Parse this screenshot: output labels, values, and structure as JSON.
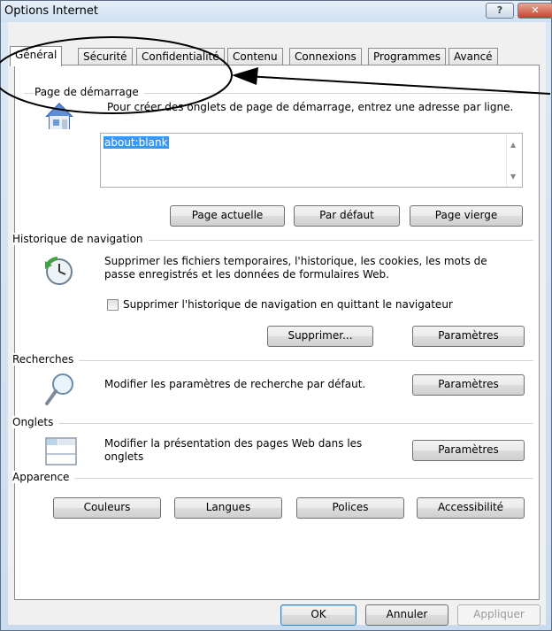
{
  "window": {
    "title": "Options Internet",
    "help_label": "?",
    "close_label": "✕"
  },
  "tabs": [
    {
      "label": "Général",
      "active": true
    },
    {
      "label": "Sécurité"
    },
    {
      "label": "Confidentialité"
    },
    {
      "label": "Contenu"
    },
    {
      "label": "Connexions"
    },
    {
      "label": "Programmes"
    },
    {
      "label": "Avancé"
    }
  ],
  "homepage": {
    "group_label": "Page de démarrage",
    "description": "Pour créer des onglets de page de démarrage, entrez une adresse par ligne.",
    "value": "about:blank",
    "icon": "house-icon",
    "buttons": {
      "current": "Page actuelle",
      "default": "Par défaut",
      "blank": "Page vierge"
    }
  },
  "history": {
    "group_label": "Historique de navigation",
    "description": "Supprimer les fichiers temporaires, l'historique, les cookies, les mots de passe enregistrés et les données de formulaires Web.",
    "checkbox_label": "Supprimer l'historique de navigation en quittant le navigateur",
    "checked": false,
    "icon": "history-clock-icon",
    "buttons": {
      "delete": "Supprimer...",
      "settings": "Paramètres"
    }
  },
  "search": {
    "group_label": "Recherches",
    "description": "Modifier les paramètres de recherche par défaut.",
    "icon": "magnifier-icon",
    "settings": "Paramètres"
  },
  "tabs_section": {
    "group_label": "Onglets",
    "description": "Modifier la présentation des pages Web dans les onglets",
    "icon": "tabs-window-icon",
    "settings": "Paramètres"
  },
  "appearance": {
    "group_label": "Apparence",
    "buttons": {
      "colors": "Couleurs",
      "languages": "Langues",
      "fonts": "Polices",
      "accessibility": "Accessibilité"
    }
  },
  "footer": {
    "ok": "OK",
    "cancel": "Annuler",
    "apply": "Appliquer"
  },
  "colors": {
    "accent": "#3399ff",
    "close": "#c2432d"
  }
}
